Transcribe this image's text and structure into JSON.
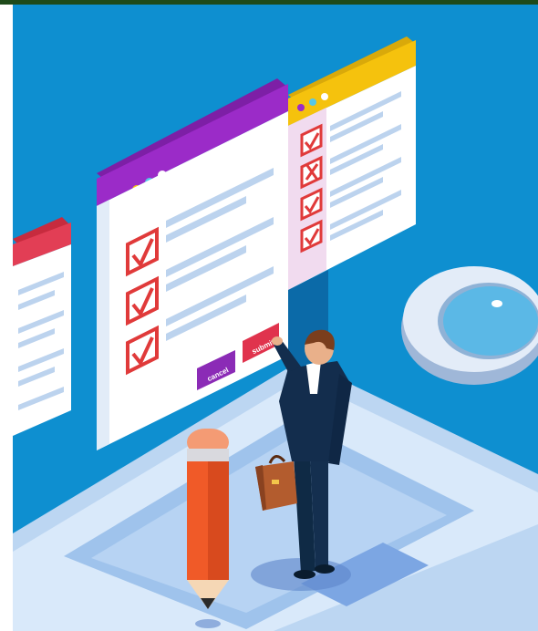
{
  "illustration": {
    "colors": {
      "top_band": "#1e4a1a",
      "background": "#0e8fd0",
      "left_strip": "#ffffff",
      "platform": "#cfe3f7",
      "form_purple": "#9b2bc8",
      "form_yellow": "#f5c20d",
      "form_red": "#d8344a",
      "check_red": "#e03a3a",
      "cancel_button": "#8b2bb6",
      "submit_button": "#e0334d",
      "pencil_orange": "#f05a28",
      "magnifier_ring": "#dde6f3",
      "magnifier_lens": "#5bb8e6"
    },
    "buttons": {
      "cancel": "cancel",
      "submit": "submit"
    },
    "forms": {
      "main_form_checks": [
        "check",
        "check",
        "check"
      ],
      "right_form_checks": [
        "check",
        "cross",
        "check",
        "check"
      ]
    }
  }
}
